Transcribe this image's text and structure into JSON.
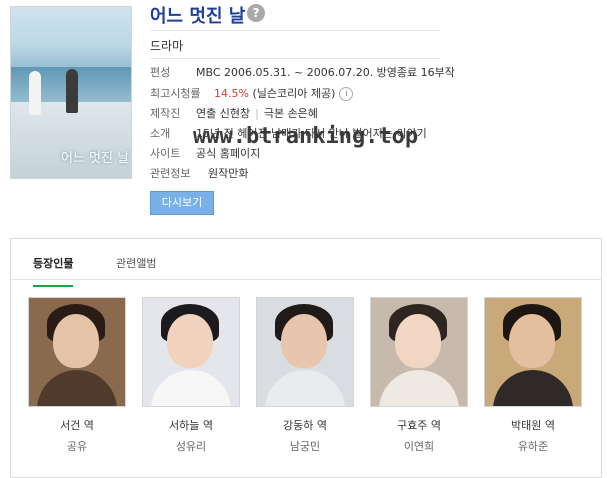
{
  "title": "어느 멋진 날",
  "help_icon": "?",
  "genre": "드라마",
  "info": {
    "broadcast_label": "편성",
    "broadcast_value": "MBC 2006.05.31. ~ 2006.07.20. 방영종료 16부작",
    "rating_label": "최고시청률",
    "rating_value": "14.5%",
    "rating_source": "(닐슨코리아 제공)",
    "rating_info_icon": "i",
    "producer_label": "제작진",
    "producer_value1": "연출 신현창",
    "producer_value2": "극본 손은혜",
    "intro_label": "소개",
    "intro_value": "15년 전 헤어진 남매가 다시 만나 벌어지는 이야기",
    "site_label": "사이트",
    "site_value": "공식 홈페이지",
    "related_label": "관련정보",
    "related_value": "원작만화"
  },
  "rewatch_button": "다시보기",
  "watermark": "www.btranking.top",
  "poster_title": "어느 멋진 날",
  "tabs": [
    "등장인물",
    "관련앨범"
  ],
  "cast": [
    {
      "role": "서건 역",
      "actor": "공유"
    },
    {
      "role": "서하늘 역",
      "actor": "성유리"
    },
    {
      "role": "강동하 역",
      "actor": "남궁민"
    },
    {
      "role": "구효주 역",
      "actor": "이연희"
    },
    {
      "role": "박태원 역",
      "actor": "유하준"
    }
  ],
  "colors": {
    "title": "#1e3f9a",
    "rating": "#e03a2f",
    "button": "#7ab0e8",
    "active_tab": "#1ca441"
  }
}
